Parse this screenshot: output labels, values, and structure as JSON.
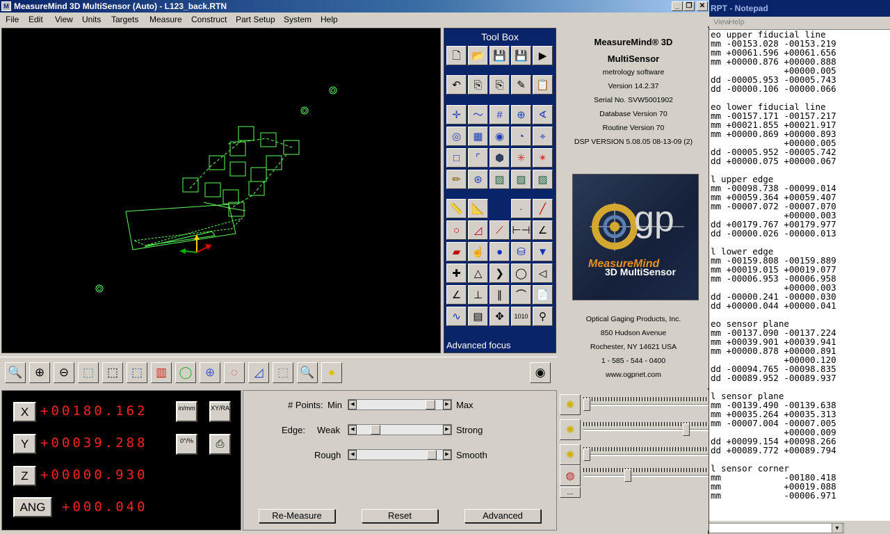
{
  "notepad": {
    "title": "RPT - Notepad",
    "menu": [
      "View",
      "Help"
    ],
    "lines": [
      "eo upper fiducial line",
      "mm -00153.028 -00153.219",
      "mm +00061.596 +00061.656",
      "mm +00000.876 +00000.888",
      "              +00000.005",
      "dd -00005.953 -00005.743",
      "dd -00000.106 -00000.066",
      "",
      "eo lower fiducial line",
      "mm -00157.171 -00157.217",
      "mm +00021.855 +00021.917",
      "mm +00000.869 +00000.893",
      "              +00000.005",
      "dd -00005.952 -00005.742",
      "dd +00000.075 +00000.067",
      "",
      "l upper edge",
      "mm -00098.738 -00099.014",
      "mm +00059.364 +00059.407",
      "mm -00007.072 -00007.070",
      "              +00000.003",
      "dd +00179.767 +00179.977",
      "dd -00000.026 -00000.013",
      "",
      "l lower edge",
      "mm -00159.808 -00159.889",
      "mm +00019.015 +00019.077",
      "mm -00006.953 -00006.958",
      "              +00000.003",
      "dd -00000.241 -00000.030",
      "dd +00000.044 +00000.041",
      "",
      "eo sensor plane",
      "mm -00137.090 -00137.224",
      "mm +00039.901 +00039.941",
      "mm +00000.878 +00000.891",
      "              +00000.120",
      "dd -00094.765 -00098.835",
      "dd -00089.952 -00089.937",
      "",
      "l sensor plane",
      "mm -00139.490 -00139.638",
      "mm +00035.264 +00035.313",
      "mm -00007.004 -00007.005",
      "              +00000.009",
      "dd +00099.154 +00098.266",
      "dd +00089.772 +00089.794",
      "",
      "l sensor corner",
      "mm            -00180.418",
      "mm            +00019.088",
      "mm            -00006.971"
    ]
  },
  "window": {
    "title": "MeasureMind 3D MultiSensor (Auto) - L123_back.RTN",
    "icon_letter": "M"
  },
  "menubar": [
    "File",
    "Edit",
    "View",
    "Units",
    "Targets",
    "Measure",
    "Construct",
    "Part Setup",
    "System",
    "Help"
  ],
  "toolbox": {
    "title": "Tool Box",
    "footer": "Advanced focus"
  },
  "info": {
    "product": "MeasureMind® 3D",
    "product2": "MultiSensor",
    "subtitle": "metrology software",
    "version": "Version 14.2.37",
    "serial": "Serial No.  SVW5001902",
    "database": "Database Version 70",
    "routine": "Routine Version 70",
    "dsp": "DSP VERSION 5.08.05 08-13-09 (2)",
    "logo_text": "gp",
    "logo_line1": "MeasureMind",
    "logo_line2": "3D MultiSensor",
    "company": "Optical Gaging Products, Inc.",
    "address1": "850 Hudson Avenue",
    "address2": "Rochester, NY 14621 USA",
    "phone": "1 - 585 - 544 - 0400",
    "website": "www.ogpnet.com"
  },
  "dro": {
    "x_label": "X",
    "x_value": "+00180.162",
    "y_label": "Y",
    "y_value": "+00039.288",
    "z_label": "Z",
    "z_value": "+00000.930",
    "ang_label": "ANG",
    "ang_value": "+000.040",
    "units_btn": "in/mm",
    "coord_btn": "XY/RA",
    "deg_btn": "0°/%"
  },
  "controls": {
    "points_label": "# Points:",
    "points_min": "Min",
    "points_max": "Max",
    "points_value": 0.9,
    "edge_label": "Edge:",
    "edge_weak": "Weak",
    "edge_strong": "Strong",
    "edge_value": 0.18,
    "rough_label": "Rough",
    "smooth_label": "Smooth",
    "rough_value": 0.92,
    "remeasure": "Re-Measure",
    "reset": "Reset",
    "advanced": "Advanced"
  },
  "lights": {
    "more": "...",
    "levels": [
      0.0,
      0.85,
      0.0,
      0.35
    ]
  },
  "colors": {
    "viewport_bg": "#000000",
    "wire": "#5cff5c",
    "dro_digits": "#ff2020",
    "toolbox_bg": "#0a246a"
  }
}
